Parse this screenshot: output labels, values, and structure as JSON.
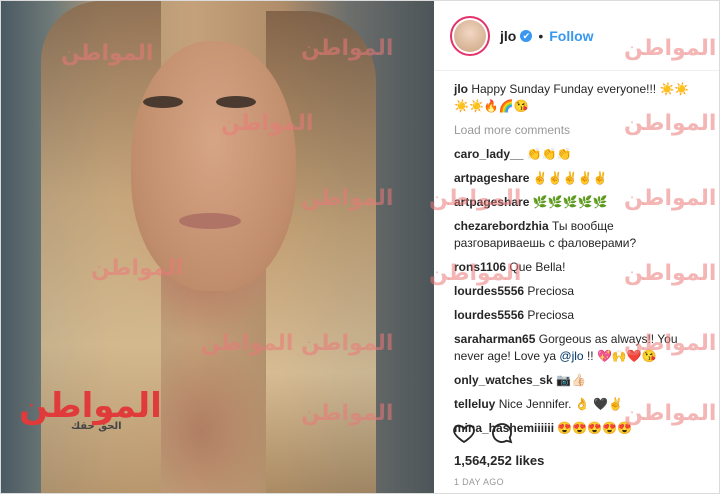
{
  "post": {
    "username": "jlo",
    "verified_glyph": "✔",
    "separator": "•",
    "follow_label": "Follow",
    "caption_user": "jlo",
    "caption_text": "Happy Sunday Funday everyone!!! ☀️☀️☀️☀️🔥🌈😘",
    "load_more": "Load more comments",
    "comments": [
      {
        "user": "caro_lady__",
        "text": "👏👏👏"
      },
      {
        "user": "artpageshare",
        "text": "✌✌✌✌✌"
      },
      {
        "user": "artpageshare",
        "text": "🌿🌿🌿🌿🌿"
      },
      {
        "user": "chezarebordzhia",
        "text": "Ты вообще разговариваешь с фаловерами?"
      },
      {
        "user": "rons1106",
        "text": "Que Bella!"
      },
      {
        "user": "lourdes5556",
        "text": "Preciosa"
      },
      {
        "user": "lourdes5556",
        "text": "Preciosa"
      },
      {
        "user": "saraharman65",
        "text": "Gorgeous as always!! You never age! Love ya",
        "mention": "@jlo",
        "tail": "!! 💖🙌❤️😘"
      },
      {
        "user": "only_watches_sk",
        "text": "📷👍🏻"
      },
      {
        "user": "telleluy",
        "text": "Nice Jennifer. 👌 🖤✌"
      },
      {
        "user": "mina_hashemiiiiii",
        "text": "😍😍😍😍😍"
      }
    ],
    "likes": "1,564,252 likes",
    "time": "1 DAY AGO"
  },
  "watermark": {
    "text": "المواطن",
    "sub": "الحق حقك"
  },
  "icons": {
    "like": "heart-icon",
    "comment": "comment-icon",
    "verified": "verified-badge-icon"
  },
  "colors": {
    "accent": "#3897f0",
    "watermark": "#e04040"
  }
}
